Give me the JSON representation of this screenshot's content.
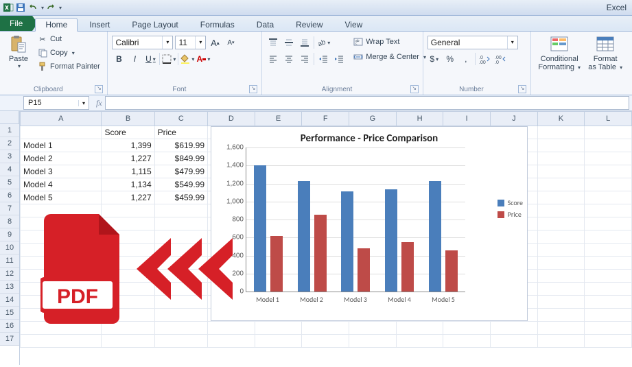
{
  "app": {
    "title_right": "Excel"
  },
  "qat": {
    "save_title": "Save",
    "undo_title": "Undo",
    "redo_title": "Redo"
  },
  "tabs": {
    "file": "File",
    "items": [
      "Home",
      "Insert",
      "Page Layout",
      "Formulas",
      "Data",
      "Review",
      "View"
    ],
    "active": "Home"
  },
  "ribbon": {
    "clipboard": {
      "label": "Clipboard",
      "paste": "Paste",
      "cut": "Cut",
      "copy": "Copy",
      "format_painter": "Format Painter"
    },
    "font": {
      "label": "Font",
      "family": "Calibri",
      "size": "11",
      "bold": "B",
      "italic": "I",
      "underline": "U"
    },
    "alignment": {
      "label": "Alignment",
      "wrap": "Wrap Text",
      "merge": "Merge & Center"
    },
    "number": {
      "label": "Number",
      "format": "General",
      "currency": "$",
      "percent": "%",
      "comma": ","
    },
    "styles": {
      "cond_fmt_1": "Conditional",
      "cond_fmt_2": "Formatting",
      "fmt_table_1": "Format",
      "fmt_table_2": "as Table"
    }
  },
  "namebox": {
    "value": "P15"
  },
  "fxbar": {
    "fx_label": "fx",
    "value": ""
  },
  "grid": {
    "col_headers": [
      "A",
      "B",
      "C",
      "D",
      "E",
      "F",
      "G",
      "H",
      "I",
      "J",
      "K",
      "L"
    ],
    "row_count": 17,
    "headers": {
      "b1": "Score",
      "c1": "Price"
    },
    "rows": [
      {
        "a": "Model 1",
        "b": "1,399",
        "c": "$619.99"
      },
      {
        "a": "Model 2",
        "b": "1,227",
        "c": "$849.99"
      },
      {
        "a": "Model 3",
        "b": "1,115",
        "c": "$479.99"
      },
      {
        "a": "Model 4",
        "b": "1,134",
        "c": "$549.99"
      },
      {
        "a": "Model 5",
        "b": "1,227",
        "c": "$459.99"
      }
    ]
  },
  "chart_data": {
    "type": "bar",
    "title": "Performance - Price Comparison",
    "categories": [
      "Model 1",
      "Model 2",
      "Model 3",
      "Model 4",
      "Model 5"
    ],
    "series": [
      {
        "name": "Score",
        "values": [
          1399,
          1227,
          1115,
          1134,
          1227
        ],
        "color": "#4a7ebb"
      },
      {
        "name": "Price",
        "values": [
          619.99,
          849.99,
          479.99,
          549.99,
          459.99
        ],
        "color": "#be4b48"
      }
    ],
    "ylim": [
      0,
      1600
    ],
    "ystep": 200,
    "xlabel": "",
    "ylabel": ""
  },
  "overlay": {
    "pdf_label": "PDF"
  }
}
